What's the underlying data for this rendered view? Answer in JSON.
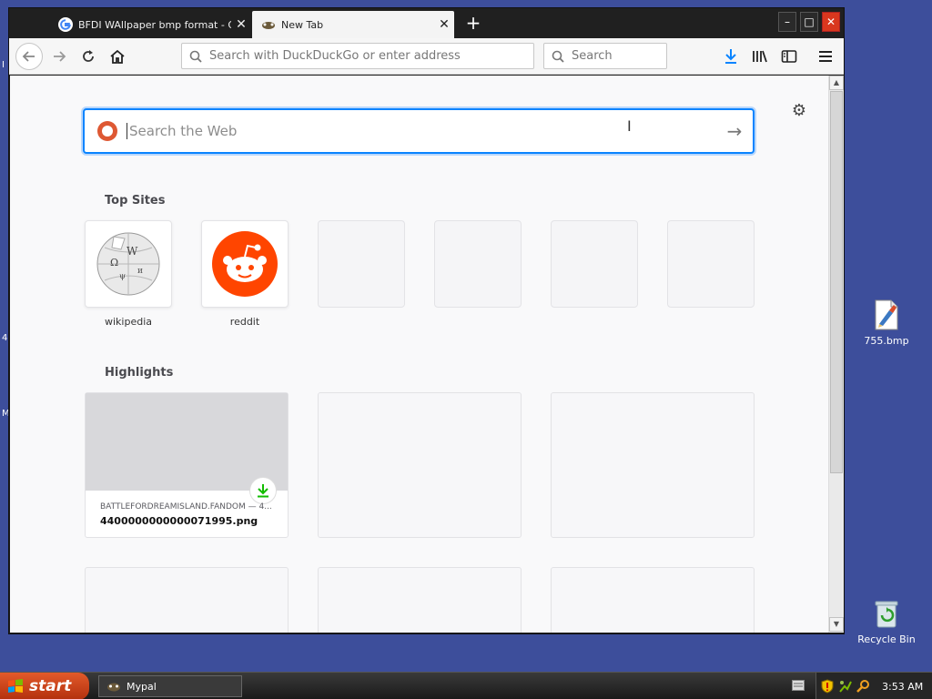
{
  "browser": {
    "tabs": [
      {
        "title": "BFDI WAllpaper bmp format - Goo",
        "active": false
      },
      {
        "title": "New Tab",
        "active": true
      }
    ],
    "newtab_symbol": "+",
    "window_controls": {
      "minimize": "–",
      "maximize": "□",
      "close": "✕"
    },
    "urlbar_placeholder": "Search with DuckDuckGo or enter address",
    "searchbar_placeholder": "Search"
  },
  "newtab": {
    "search_placeholder": "Search the Web",
    "go_arrow": "→",
    "top_sites_title": "Top Sites",
    "top_sites": [
      {
        "label": "wikipedia"
      },
      {
        "label": "reddit"
      }
    ],
    "highlights_title": "Highlights",
    "highlight": {
      "source": "BATTLEFORDREAMISLAND.FANDOM — 4...",
      "filename": "4400000000000071995.png"
    }
  },
  "desktop": {
    "icons": [
      {
        "label": "755.bmp"
      },
      {
        "label": "Recycle Bin"
      }
    ],
    "edge_marks": [
      "I",
      "4",
      "M"
    ]
  },
  "taskbar": {
    "start_label": "start",
    "task_label": "Mypal",
    "clock": "3:53 AM"
  },
  "colors": {
    "desktop": "#3d4e9b",
    "focus_ring": "#0a84ff",
    "reddit": "#ff4500",
    "duckduckgo": "#de5833",
    "download_green": "#12bc00",
    "download_blue": "#0a84ff"
  }
}
